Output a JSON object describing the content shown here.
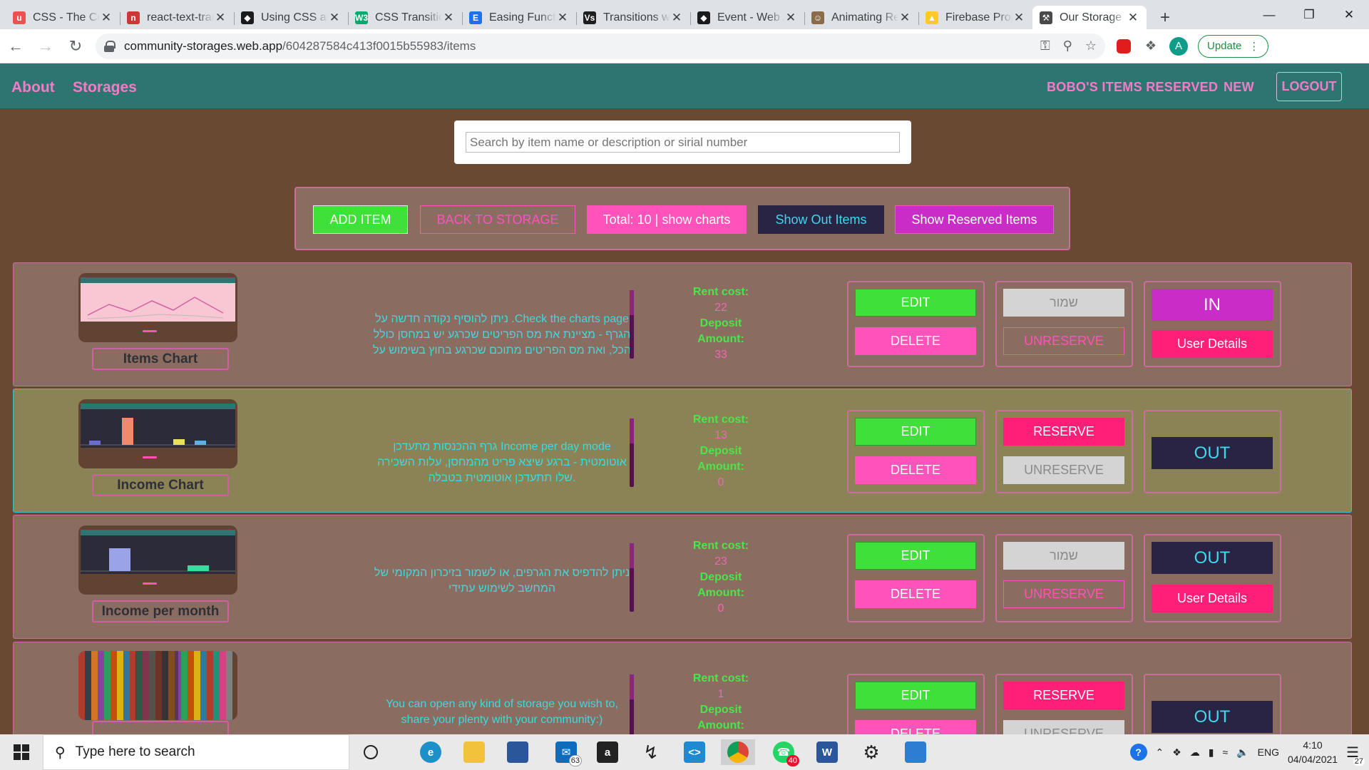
{
  "browser": {
    "tabs": [
      {
        "title": "CSS - The Complete Guide",
        "fav": "u",
        "color": "#ec5252"
      },
      {
        "title": "react-text-transition",
        "fav": "n",
        "color": "#cb3837"
      },
      {
        "title": "Using CSS animations",
        "fav": "◆",
        "color": "#1b1b1b"
      },
      {
        "title": "CSS Transitions",
        "fav": "W3",
        "color": "#04aa6d"
      },
      {
        "title": "Easing Functions",
        "fav": "E",
        "color": "#1a73e8"
      },
      {
        "title": "Transitions with",
        "fav": "Vs",
        "color": "#1e1e1e"
      },
      {
        "title": "Event - Web APIs",
        "fav": "◆",
        "color": "#1b1b1b"
      },
      {
        "title": "Animating React",
        "fav": "☺",
        "color": "#8a6b4a"
      },
      {
        "title": "Firebase Project",
        "fav": "▲",
        "color": "#ffca28"
      },
      {
        "title": "Our Storage",
        "fav": "⚒",
        "color": "#4a4a4a",
        "active": true
      }
    ],
    "url_host": "community-storages.web.app",
    "url_path": "/604287584c413f0015b55983/items",
    "profile_initial": "A",
    "update_label": "Update"
  },
  "nav": {
    "about": "About",
    "storages": "Storages",
    "reserved": "BOBO'S ITEMS RESERVED",
    "new": "NEW",
    "logout": "LOGOUT"
  },
  "search": {
    "placeholder": "Search by item name or description or sirial number"
  },
  "actions": {
    "add_item": "ADD ITEM",
    "back": "BACK TO STORAGE",
    "total": "Total: 10 | show charts",
    "show_out": "Show Out Items",
    "show_reserved": "Show Reserved Items"
  },
  "labels": {
    "rent_cost": "Rent cost:",
    "deposit": "Deposit",
    "amount": "Amount:",
    "edit": "EDIT",
    "delete": "DELETE",
    "unreserve": "UNRESERVE",
    "reserve": "RESERVE",
    "user_details": "User Details"
  },
  "items": [
    {
      "name": "Items Chart",
      "description": "ניתן להוסיף נקודה חדשה על .Check the charts page הגרף - מציינת את מס הפריטים שכרגע יש במחסן כולל הכל, ואת מס הפריטים מתוכם שכרגע בחוץ בשימוש על",
      "rent_cost": "22",
      "deposit": "33",
      "reserve_label": "שמור",
      "status": "IN",
      "highlighted": false
    },
    {
      "name": "Income Chart",
      "description": "גרף ההכנסות מתעדכן Income per day mode אוטומטית - ברגע שיצא פריט מהמחסן, עלות השכירה שלו תתעדכן אוטומטית בטבלה.",
      "rent_cost": "13",
      "deposit": "0",
      "reserve_label": "RESERVE",
      "status": "OUT",
      "highlighted": true
    },
    {
      "name": "Income per month",
      "description": "ניתן להדפיס את הגרפים, או לשמור בזיכרון המקומי של המחשב לשימוש עתידי",
      "rent_cost": "23",
      "deposit": "0",
      "reserve_label": "שמור",
      "status": "OUT",
      "highlighted": false
    },
    {
      "name": "",
      "description": "You can open any kind of storage you wish to, share your plenty with your community:)",
      "rent_cost": "1",
      "deposit": "",
      "reserve_label": "RESERVE",
      "status": "OUT",
      "highlighted": false
    }
  ],
  "taskbar": {
    "search_placeholder": "Type here to search",
    "mail_badge": "63",
    "whatsapp_badge": "40",
    "lang": "ENG",
    "time": "4:10",
    "date": "04/04/2021",
    "notif": "27"
  }
}
